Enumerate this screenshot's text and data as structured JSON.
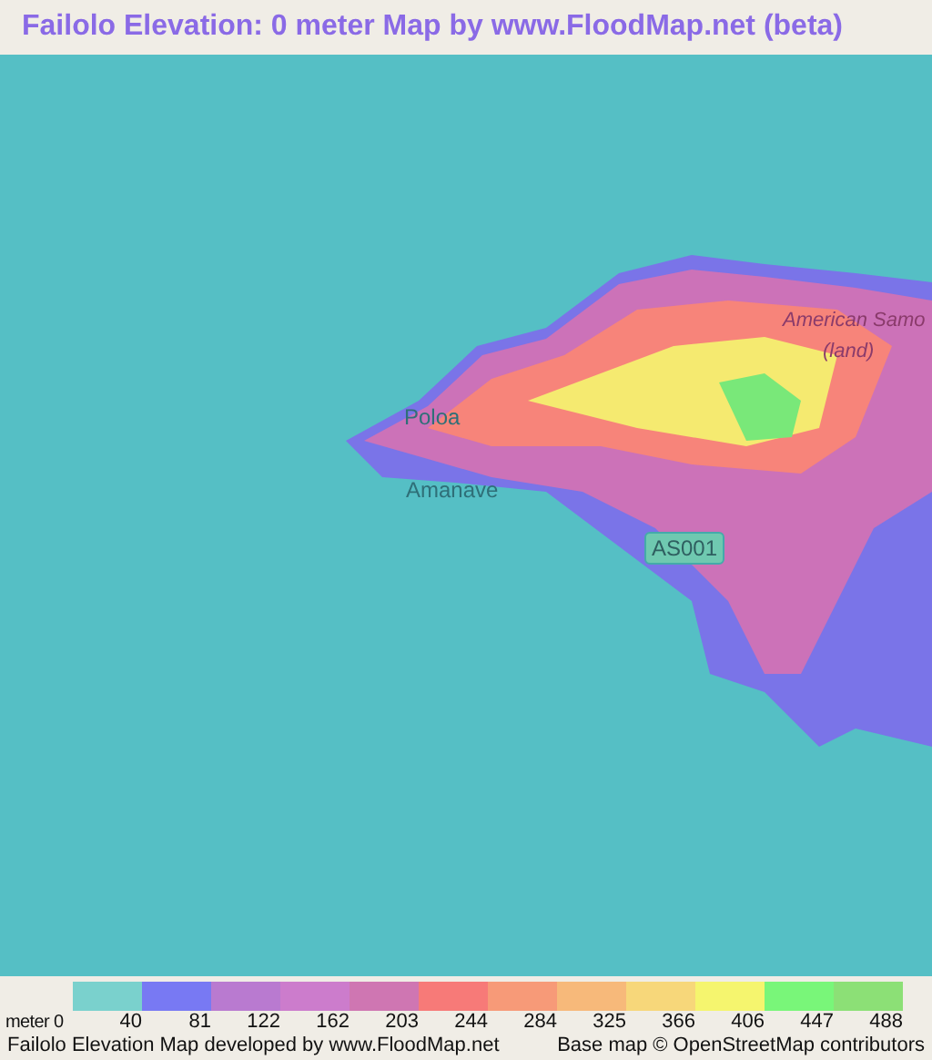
{
  "title": "Failolo Elevation: 0 meter Map by www.FloodMap.net (beta)",
  "map": {
    "labels": [
      {
        "text": "Poloa",
        "kind": "place"
      },
      {
        "text": "Amanave",
        "kind": "place"
      },
      {
        "text": "American Samo",
        "kind": "region"
      },
      {
        "text": "(land)",
        "kind": "region"
      },
      {
        "text": "AS001",
        "kind": "road"
      }
    ]
  },
  "legend": {
    "unit_label": "meter 0",
    "items": [
      {
        "label": "40",
        "color": "#7ad1cd"
      },
      {
        "label": "81",
        "color": "#7879f3"
      },
      {
        "label": "122",
        "color": "#b97ad0"
      },
      {
        "label": "162",
        "color": "#cc7ccc"
      },
      {
        "label": "203",
        "color": "#cf76b2"
      },
      {
        "label": "244",
        "color": "#f77a78"
      },
      {
        "label": "284",
        "color": "#f79a78"
      },
      {
        "label": "325",
        "color": "#f7b97a"
      },
      {
        "label": "366",
        "color": "#f7d77a"
      },
      {
        "label": "406",
        "color": "#f5f56e"
      },
      {
        "label": "447",
        "color": "#79f679"
      },
      {
        "label": "488",
        "color": "#8ce076"
      }
    ]
  },
  "footer": {
    "left": "Failolo Elevation Map developed by www.FloodMap.net",
    "right": "Base map © OpenStreetMap contributors"
  }
}
